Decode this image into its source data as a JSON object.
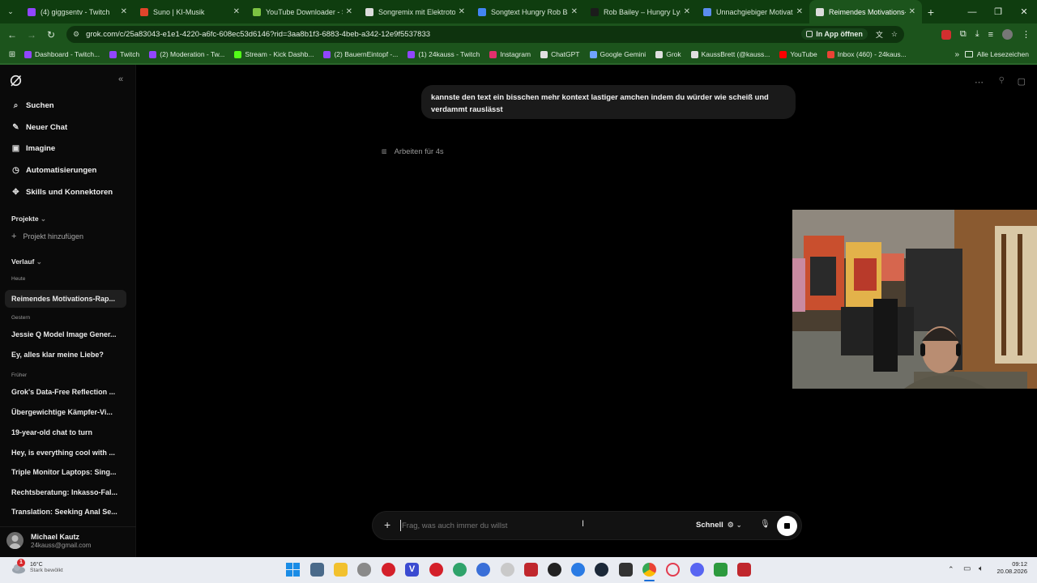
{
  "browser": {
    "tabs": [
      {
        "title": "(4) giggsentv - Twitch",
        "color": "#9146ff",
        "active": false
      },
      {
        "title": "Suno | KI-Musik",
        "color": "#e0452b",
        "active": false
      },
      {
        "title": "YouTube Downloader - S",
        "color": "#7cc242",
        "active": false
      },
      {
        "title": "Songremix mit Elektrotou",
        "color": "#dcdcdc",
        "active": false
      },
      {
        "title": "Songtext Hungry Rob Bai",
        "color": "#4285f4",
        "active": false
      },
      {
        "title": "Rob Bailey – Hungry Lyric",
        "color": "#1c1c1c",
        "active": false
      },
      {
        "title": "Unnachgiebiger Motivati",
        "color": "#5b8def",
        "active": false
      },
      {
        "title": "Reimendes Motivations-I",
        "color": "#dcdcdc",
        "active": true
      }
    ],
    "url": "grok.com/c/25a83043-e1e1-4220-a6fc-608ec53d6146?rid=3aa8b1f3-6883-4beb-a342-12e9f5537833",
    "open_in_app": "In App öffnen",
    "bookmarks": [
      {
        "label": "Dashboard - Twitch...",
        "color": "#9146ff"
      },
      {
        "label": "Twitch",
        "color": "#9146ff"
      },
      {
        "label": "(2) Moderation - Tw...",
        "color": "#9146ff"
      },
      {
        "label": "Stream - Kick Dashb...",
        "color": "#53fc18"
      },
      {
        "label": "(2) BauernEintopf -...",
        "color": "#9146ff"
      },
      {
        "label": "(1) 24kauss - Twitch",
        "color": "#9146ff"
      },
      {
        "label": "Instagram",
        "color": "#e1306c"
      },
      {
        "label": "ChatGPT",
        "color": "#e0e0e0"
      },
      {
        "label": "Google Gemini",
        "color": "#6fa3ff"
      },
      {
        "label": "Grok",
        "color": "#e0e0e0"
      },
      {
        "label": "KaussBrett (@kauss...",
        "color": "#e0e0e0"
      },
      {
        "label": "YouTube",
        "color": "#ff0000"
      },
      {
        "label": "Inbox (460) - 24kaus...",
        "color": "#ea4335"
      }
    ],
    "all_bookmarks": "Alle Lesezeichen"
  },
  "sidebar": {
    "nav": [
      {
        "label": "Suchen",
        "icon": "search-icon"
      },
      {
        "label": "Neuer Chat",
        "icon": "new-chat-icon"
      },
      {
        "label": "Imagine",
        "icon": "imagine-icon"
      },
      {
        "label": "Automatisierungen",
        "icon": "automation-icon"
      },
      {
        "label": "Skills und Konnektoren",
        "icon": "skills-icon"
      }
    ],
    "projects_heading": "Projekte",
    "add_project": "Projekt hinzufügen",
    "history_heading": "Verlauf",
    "today": "Heute",
    "today_items": [
      "Reimendes Motivations-Rap..."
    ],
    "yesterday": "Gestern",
    "yesterday_items": [
      "Jessie Q Model Image Gener...",
      "Ey, alles klar meine Liebe?"
    ],
    "earlier": "Früher",
    "earlier_items": [
      "Grok's Data-Free Reflection ...",
      "Übergewichtige Kämpfer-Vi...",
      "19-year-old chat to turn",
      "Hey, is everything cool with ...",
      "Triple Monitor Laptops: Sing...",
      "Rechtsberatung: Inkasso-Fal...",
      "Translation: Seeking Anal Se..."
    ],
    "user_name": "Michael Kautz",
    "user_email": "24kauss@gmail.com"
  },
  "chat": {
    "user_message": "kannste den text ein bisschen mehr kontext lastiger amchen indem du würder wie scheiß und verdammt rauslässt",
    "thinking": "Arbeiten für 4s",
    "input_placeholder": "Frag, was auch immer du willst",
    "mode": "Schnell"
  },
  "taskbar": {
    "temperature": "16°C",
    "weather": "Stark bewölkt",
    "time": "09:12",
    "date": "20.08.2026",
    "weather_badge": "1"
  }
}
